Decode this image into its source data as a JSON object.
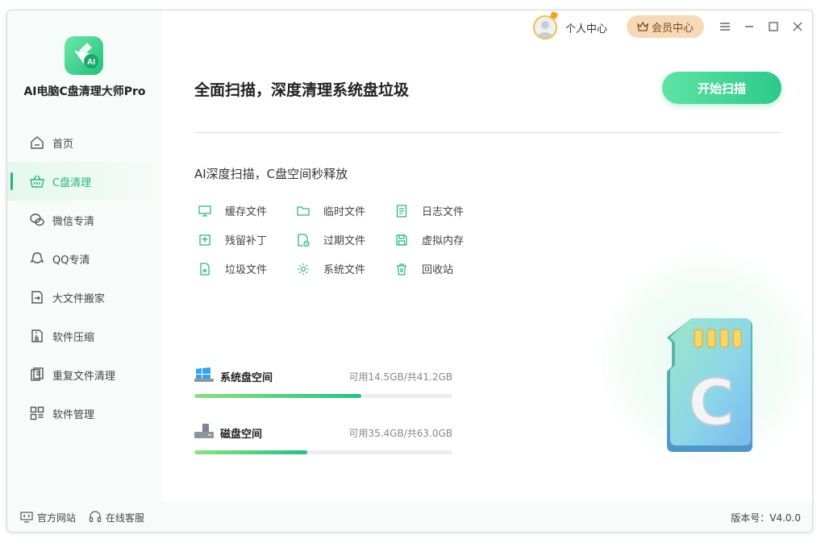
{
  "app": {
    "name": "AI电脑C盘清理大师Pro",
    "logo_text": "AI"
  },
  "sidebar": {
    "items": [
      {
        "label": "首页",
        "icon": "home-icon"
      },
      {
        "label": "C盘清理",
        "icon": "basket-icon",
        "active": true
      },
      {
        "label": "微信专清",
        "icon": "wechat-icon"
      },
      {
        "label": "QQ专清",
        "icon": "qq-icon"
      },
      {
        "label": "大文件搬家",
        "icon": "move-file-icon"
      },
      {
        "label": "软件压缩",
        "icon": "compress-icon"
      },
      {
        "label": "重复文件清理",
        "icon": "duplicate-icon"
      },
      {
        "label": "软件管理",
        "icon": "apps-icon"
      }
    ]
  },
  "topbar": {
    "personal_label": "个人中心",
    "vip_label": "会员中心"
  },
  "main": {
    "headline": "全面扫描，深度清理系统盘垃圾",
    "scan_button": "开始扫描",
    "subtitle": "AI深度扫描，C盘空间秒释放",
    "features": [
      {
        "label": "缓存文件",
        "icon": "monitor-icon"
      },
      {
        "label": "临时文件",
        "icon": "folder-icon"
      },
      {
        "label": "日志文件",
        "icon": "document-icon"
      },
      {
        "label": "残留补丁",
        "icon": "patch-icon"
      },
      {
        "label": "过期文件",
        "icon": "expired-file-icon"
      },
      {
        "label": "虚拟内存",
        "icon": "save-icon"
      },
      {
        "label": "垃圾文件",
        "icon": "junk-file-icon"
      },
      {
        "label": "系统文件",
        "icon": "settings-icon"
      },
      {
        "label": "回收站",
        "icon": "trash-icon"
      }
    ],
    "disks": [
      {
        "name": "系统盘空间",
        "available": "可用14.5GB/共41.2GB",
        "used_fraction": 0.648,
        "icon": "windows-drive-icon"
      },
      {
        "name": "磁盘空间",
        "available": "可用35.4GB/共63.0GB",
        "used_fraction": 0.438,
        "icon": "hard-drive-icon"
      }
    ],
    "illustration_letter": "C"
  },
  "footer": {
    "website_label": "官方网站",
    "support_label": "在线客服",
    "version": "版本号：V4.0.0"
  },
  "colors": {
    "accent": "#26b873",
    "button_start": "#5fe3a5",
    "button_end": "#2dc98a",
    "vip_bg": "#f6d9b6"
  }
}
